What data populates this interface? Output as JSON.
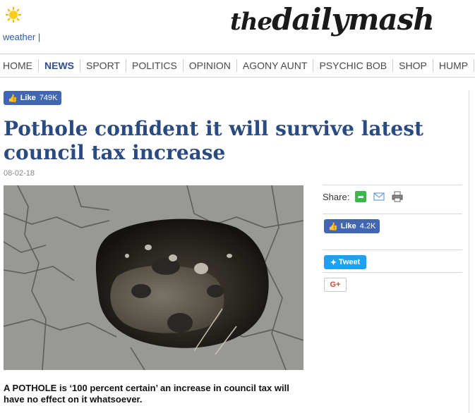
{
  "header": {
    "weather_label": "weather |",
    "logo_the": "the",
    "logo_main": "dailymash"
  },
  "nav": {
    "items": [
      "HOME",
      "NEWS",
      "SPORT",
      "POLITICS",
      "OPINION",
      "AGONY AUNT",
      "PSYCHIC BOB",
      "SHOP",
      "HUMP"
    ],
    "active": "NEWS"
  },
  "page_like": {
    "label": "Like",
    "count": "749K"
  },
  "article": {
    "title": "Pothole confident it will survive latest council tax increase",
    "date": "08-02-18",
    "image_alt": "Pothole filled with water and gravel in cracked asphalt",
    "lede": "A POTHOLE is ‘100 percent certain’ an increase in council tax will have no effect on it whatsoever."
  },
  "share": {
    "label": "Share:",
    "like_label": "Like",
    "like_count": "4.2K",
    "tweet_label": "Tweet",
    "gplus_label": "G+"
  },
  "colors": {
    "nav_active": "#2f4f93",
    "title": "#2a4a82",
    "facebook": "#4267b2",
    "twitter": "#1da1f2",
    "share_green": "#3fb54f"
  }
}
